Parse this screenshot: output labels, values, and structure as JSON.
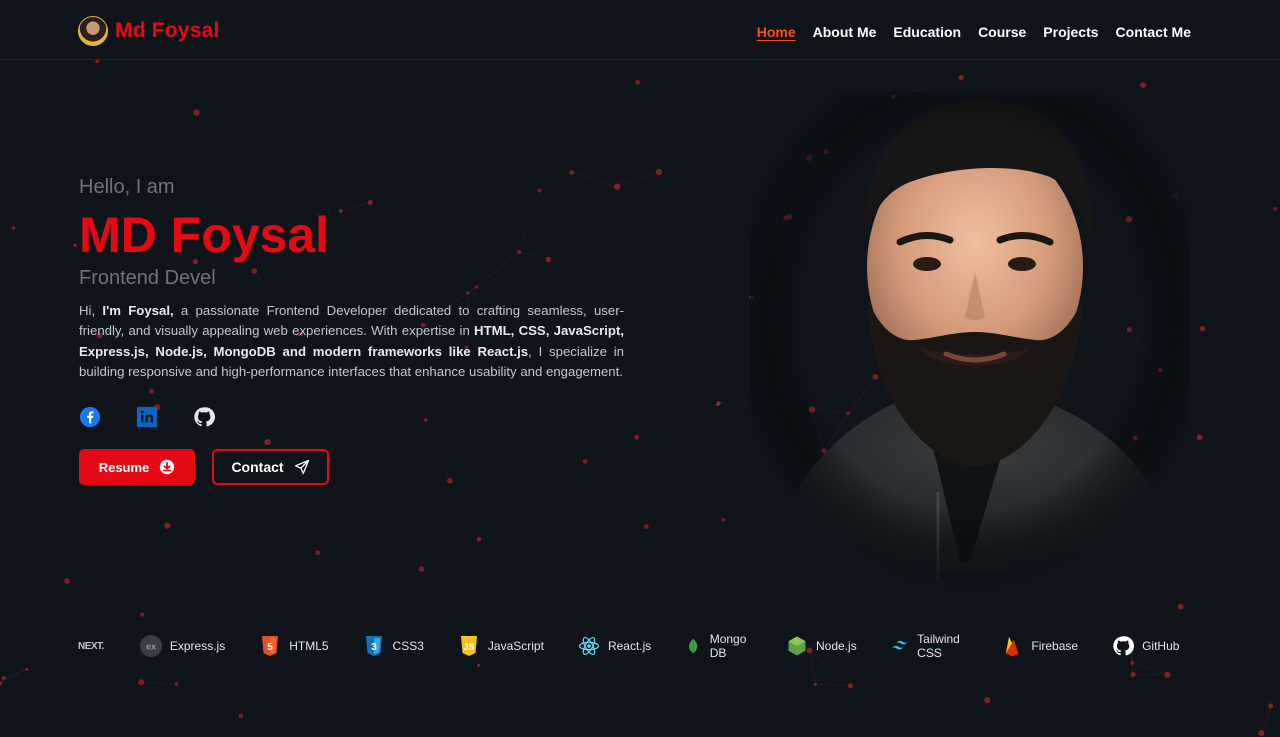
{
  "brand": {
    "name": "Md Foysal"
  },
  "nav": {
    "links": [
      "Home",
      "About Me",
      "Education",
      "Course",
      "Projects",
      "Contact Me"
    ],
    "active": "Home"
  },
  "hero": {
    "greeting": "Hello, I am",
    "name": "MD Foysal",
    "role": "Frontend Devel",
    "bio_parts": [
      {
        "t": "Hi, ",
        "b": false
      },
      {
        "t": "I'm Foysal,",
        "b": true
      },
      {
        "t": " a passionate Frontend Developer dedicated to crafting seamless, user-friendly, and visually appealing web experiences. With expertise in ",
        "b": false
      },
      {
        "t": "HTML, CSS, JavaScript, Express.js, Node.js, MongoDB and modern frameworks like React.js",
        "b": true
      },
      {
        "t": ", I specialize in building responsive and high-performance interfaces that enhance usability and engagement.",
        "b": false
      }
    ],
    "resume_label": "Resume",
    "contact_label": "Contact"
  },
  "socials": [
    {
      "name": "facebook-icon",
      "color": "#1877f2"
    },
    {
      "name": "linkedin-icon",
      "color": "#0a66c2"
    },
    {
      "name": "github-icon",
      "color": "#e6e6e6"
    }
  ],
  "tech": {
    "lead_logo": "NEXT.",
    "items": [
      {
        "label": "Express.js",
        "icon": "express-icon"
      },
      {
        "label": "HTML5",
        "icon": "html5-icon"
      },
      {
        "label": "CSS3",
        "icon": "css3-icon"
      },
      {
        "label": "JavaScript",
        "icon": "javascript-icon"
      },
      {
        "label": "React.js",
        "icon": "react-icon"
      },
      {
        "label": "Mongo DB",
        "icon": "mongodb-icon"
      },
      {
        "label": "Node.js",
        "icon": "nodejs-icon"
      },
      {
        "label": "Tailwind CSS",
        "icon": "tailwind-icon"
      },
      {
        "label": "Firebase",
        "icon": "firebase-icon"
      },
      {
        "label": "GitHub",
        "icon": "github-icon"
      }
    ]
  },
  "colors": {
    "accent": "#e50914",
    "nav_active": "#ff4b1a",
    "background": "#0f141b"
  }
}
